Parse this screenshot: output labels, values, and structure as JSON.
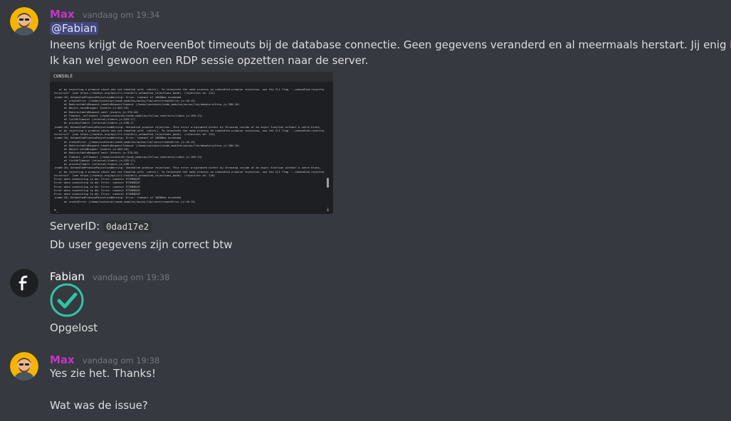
{
  "messages": [
    {
      "author": "Max",
      "timestamp": "vandaag om 19:34",
      "mention": "@Fabian",
      "text_1": "Ineens krijgt de RoerveenBot timeouts bij de database connectie. Geen gegevens veranderd en al meermaals herstart. Jij enig idee?",
      "text_2": "Ik kan wel gewoon een RDP sessie opzetten naar de server.",
      "console": {
        "title": "CONSOLE",
        "prompt": ">_",
        "lines": [
          "   or by rejecting a promise which was not handled with .catch(). To terminate the node process on unhandled promise rejection, use the CLI flag `--unhandled-rejectio",
          "ns=strict` (see https://nodejs.org/api/cli.html#cli_unhandled_rejections_mode). (rejection id: 122)",
          "(node:16) UnhandledPromiseRejectionWarning: Error: timeout of 10000ms exceeded",
          "      at createError (/home/container/node_modules/axios/lib/core/createError.js:16:15)",
          "      at RedirectableRequest.handleRequestTimeout (/home/container/node_modules/axios/lib/adapters/http.js:280:16)",
          "      at Object.onceWrapper (events.js:482:28)",
          "      at RedirectableRequest.emit (events.js:376:20)",
          "      at Timeout._onTimeout (/home/container/node_modules/follow-redirects/index.js:166:13)",
          "      at listOnTimeout (internal/timers.js:555:17)",
          "      at processTimers (internal/timers.js:498:7)",
          "(node:16) UnhandledPromiseRejectionWarning: Unhandled promise rejection. This error originated either by throwing inside of an async function without a catch block,",
          "   or by rejecting a promise which was not handled with .catch(). To terminate the node process on unhandled promise rejection, use the CLI flag `--unhandled-rejectio",
          "ns=strict` (see https://nodejs.org/api/cli.html#cli_unhandled_rejections_mode). (rejection id: 124)",
          "(node:16) UnhandledPromiseRejectionWarning: Error: timeout of 10000ms exceeded",
          "      at createError (/home/container/node_modules/axios/lib/core/createError.js:16:15)",
          "      at RedirectableRequest.handleRequestTimeout (/home/container/node_modules/axios/lib/adapters/http.js:280:16)",
          "      at Object.onceWrapper (events.js:482:28)",
          "      at RedirectableRequest.emit (events.js:376:20)",
          "      at Timeout._onTimeout (/home/container/node_modules/follow-redirects/index.js:166:13)",
          "      at listOnTimeout (internal/timers.js:555:17)",
          "      at processTimers (internal/timers.js:498:7)",
          "(node:16) UnhandledPromiseRejectionWarning: Unhandled promise rejection. This error originated either by throwing inside of an async function without a catch block,",
          "   or by rejecting a promise which was not handled with .catch(). To terminate the node process on unhandled promise rejection, use the CLI flag `--unhandled-rejectio",
          "ns=strict` (see https://nodejs.org/api/cli.html#cli_unhandled_rejections_mode). (rejection id: 126)",
          "Error when connecting to db: Error: connect ETIMEDOUT",
          "Error when connecting to db: Error: connect ETIMEDOUT",
          "Error when connecting to db: Error: connect ETIMEDOUT",
          "Error when connecting to db: Error: connect ETIMEDOUT",
          "Error when connecting to db: Error: connect ETIMEDOUT",
          "(node:16) UnhandledPromiseRejectionWarning: Error: timeout of 10000ms exceeded",
          "      at createError (/home/container/node_modules/axios/lib/core/createError.js:16:15)"
        ]
      },
      "server_label": "ServerID:",
      "server_id": "0dad17e2",
      "text_3": "Db user gegevens zijn correct btw"
    },
    {
      "author": "Fabian",
      "timestamp": "vandaag om 19:38",
      "text_1": "Opgelost"
    },
    {
      "author": "Max",
      "timestamp": "vandaag om 19:38",
      "text_1": "Yes zie het. Thanks!",
      "text_2": "Wat was de issue?"
    }
  ],
  "colors": {
    "background": "#36393f",
    "max_name": "#c734c7",
    "check_teal": "#2ec4a6"
  }
}
